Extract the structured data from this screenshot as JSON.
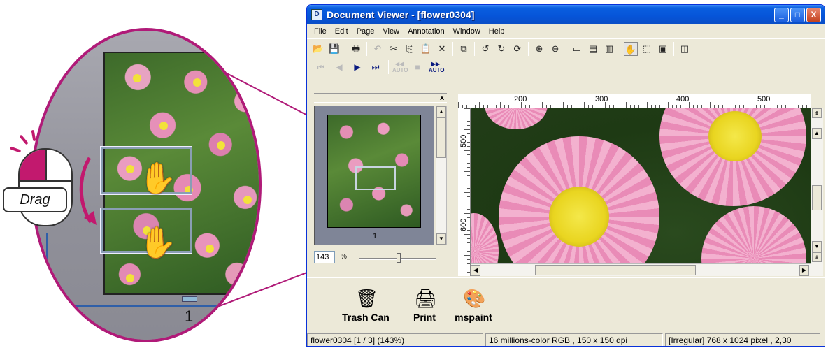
{
  "callout": {
    "mouse_label": "Drag",
    "magnified_page_number": "1"
  },
  "window": {
    "title": "Document Viewer - [flower0304]",
    "controls": {
      "minimize": "_",
      "maximize": "□",
      "close": "X"
    }
  },
  "menu": [
    "File",
    "Edit",
    "Page",
    "View",
    "Annotation",
    "Window",
    "Help"
  ],
  "toolbar_icons": [
    "open-folder-icon",
    "save-icon",
    "print-icon",
    "undo-icon",
    "cut-icon",
    "copy-icon",
    "paste-icon",
    "delete-icon",
    "copy-page-icon",
    "rotate-left-icon",
    "rotate-right-icon",
    "rotate-icon",
    "zoom-in-icon",
    "zoom-out-icon",
    "fit-page-icon",
    "fit-width-icon",
    "fit-height-icon",
    "hand-tool-icon",
    "select-area-icon",
    "crop-icon",
    "thumbnail-toggle-icon"
  ],
  "nav_buttons": {
    "auto_label": "AUTO"
  },
  "thumbnail_pane": {
    "close": "x",
    "page_number": "1",
    "zoom_value": "143",
    "zoom_unit": "%"
  },
  "rulers": {
    "top_labels": [
      "200",
      "300",
      "400",
      "500"
    ],
    "left_labels": [
      "500",
      "600"
    ]
  },
  "desktop_items": [
    {
      "label": "Trash Can",
      "icon": "trash-can-icon"
    },
    {
      "label": "Print",
      "icon": "printer-icon"
    },
    {
      "label": "mspaint",
      "icon": "paint-icon"
    }
  ],
  "status": {
    "page_info": "flower0304 [1 / 3] (143%)",
    "color_info": "16 millions-color RGB ,  150 x 150 dpi",
    "size_info": "[Irregular]  768 x 1024 pixel , 2,30"
  },
  "colors": {
    "accent_magenta": "#b01a78",
    "title_blue": "#0654d8"
  }
}
